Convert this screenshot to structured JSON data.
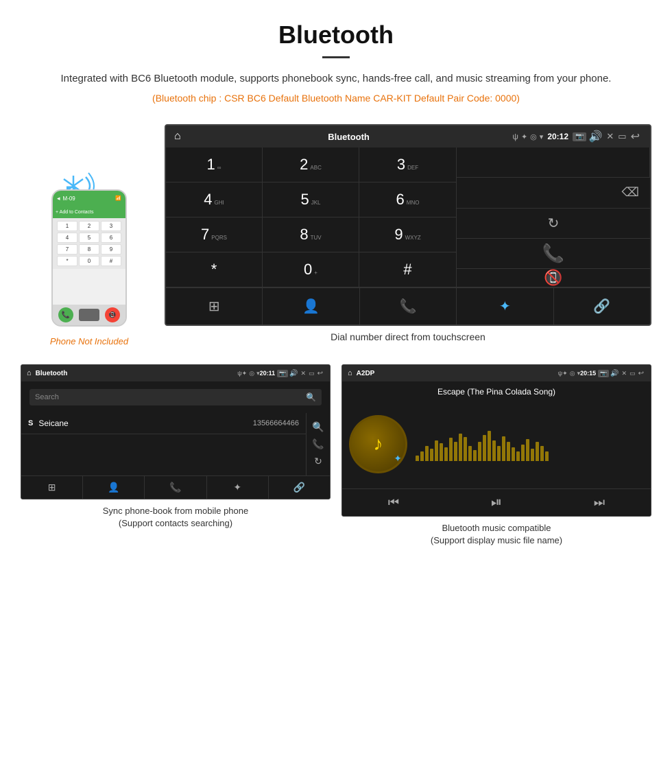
{
  "header": {
    "title": "Bluetooth",
    "description": "Integrated with BC6 Bluetooth module, supports phonebook sync, hands-free call, and music streaming from your phone.",
    "specs": "(Bluetooth chip : CSR BC6    Default Bluetooth Name CAR-KIT    Default Pair Code: 0000)"
  },
  "phone_label": "Phone Not Included",
  "car_dial": {
    "status_bar": {
      "title": "Bluetooth",
      "usb": "ψ",
      "time": "20:12"
    },
    "keys": [
      {
        "num": "1",
        "sub": "∞"
      },
      {
        "num": "2",
        "sub": "ABC"
      },
      {
        "num": "3",
        "sub": "DEF"
      },
      {
        "num": "4",
        "sub": "GHI"
      },
      {
        "num": "5",
        "sub": "JKL"
      },
      {
        "num": "6",
        "sub": "MNO"
      },
      {
        "num": "7",
        "sub": "PQRS"
      },
      {
        "num": "8",
        "sub": "TUV"
      },
      {
        "num": "9",
        "sub": "WXYZ"
      },
      {
        "num": "*",
        "sub": ""
      },
      {
        "num": "0",
        "sub": "+"
      },
      {
        "num": "#",
        "sub": ""
      }
    ],
    "caption": "Dial number direct from touchscreen"
  },
  "phonebook_screen": {
    "status_bar": {
      "title": "Bluetooth",
      "time": "20:11"
    },
    "search_placeholder": "Search",
    "contact": {
      "letter": "S",
      "name": "Seicane",
      "number": "13566664466"
    },
    "caption_line1": "Sync phone-book from mobile phone",
    "caption_line2": "(Support contacts searching)"
  },
  "music_screen": {
    "status_bar": {
      "title": "A2DP",
      "time": "20:15"
    },
    "song_title": "Escape (The Pina Colada Song)",
    "caption_line1": "Bluetooth music compatible",
    "caption_line2": "(Support display music file name)"
  },
  "visualizer_bars": [
    8,
    14,
    22,
    18,
    30,
    26,
    20,
    34,
    28,
    40,
    35,
    22,
    16,
    28,
    38,
    44,
    30,
    22,
    36,
    28,
    20,
    14,
    24,
    32,
    18,
    28,
    22,
    14
  ]
}
